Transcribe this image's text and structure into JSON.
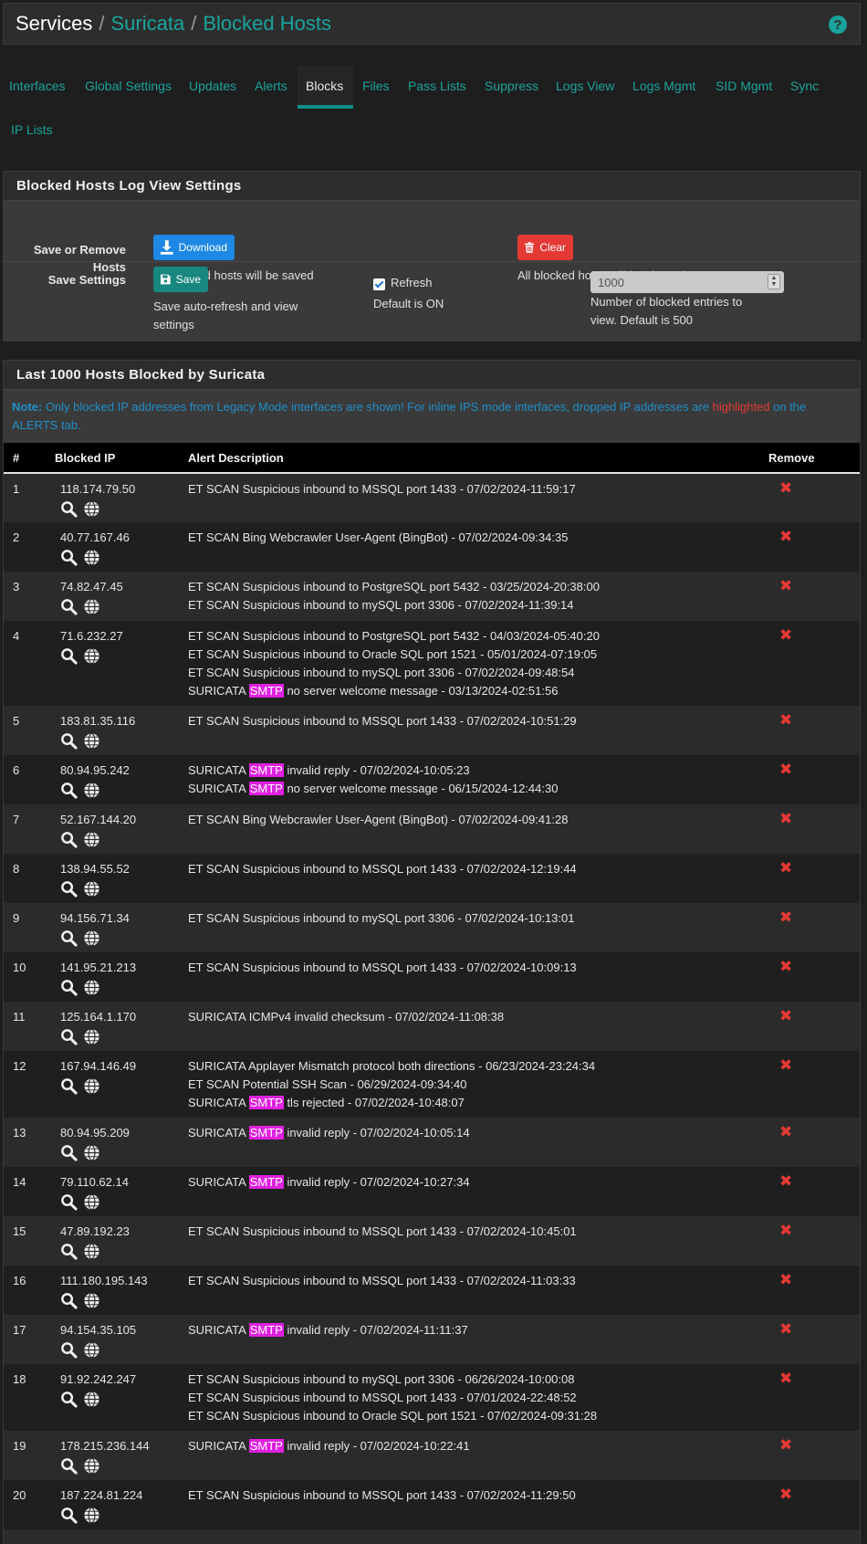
{
  "breadcrumb": {
    "root": "Services",
    "sep": "/",
    "level1": "Suricata",
    "level2": "Blocked Hosts",
    "help": "?"
  },
  "tabs": [
    "Interfaces",
    "Global Settings",
    "Updates",
    "Alerts",
    "Blocks",
    "Files",
    "Pass Lists",
    "Suppress",
    "Logs View",
    "Logs Mgmt",
    "SID Mgmt",
    "Sync",
    "IP Lists"
  ],
  "active_tab": "Blocks",
  "settings_panel": {
    "title": "Blocked Hosts Log View Settings",
    "save_remove_label_1": "Save or Remove",
    "save_remove_label_2": "Hosts",
    "download_label": "Download",
    "download_hint": "All blocked hosts will be saved",
    "clear_label": "Clear",
    "clear_hint": "All blocked hosts will be cleared",
    "save_settings_label": "Save Settings",
    "save_label": "Save",
    "save_hint_1": "Save auto-refresh and view",
    "save_hint_2": "settings",
    "refresh_label": "Refresh",
    "refresh_checked": true,
    "refresh_hint": "Default is ON",
    "entries_value": "1000",
    "entries_hint_1": "Number of blocked entries to",
    "entries_hint_2": "view. Default is 500"
  },
  "blocked_panel": {
    "title": "Last 1000 Hosts Blocked by Suricata",
    "note_label": "Note:",
    "note_text_1": " Only blocked IP addresses from Legacy Mode interfaces are shown! For inline IPS mode interfaces, dropped IP addresses are ",
    "note_highlight": "highlighted",
    "note_text_2": " on the ALERTS tab."
  },
  "table": {
    "headers": {
      "num": "#",
      "ip": "Blocked IP",
      "desc": "Alert Description",
      "remove": "Remove"
    },
    "rows": [
      {
        "num": "1",
        "ip": "118.174.79.50",
        "alerts": [
          "ET SCAN Suspicious inbound to MSSQL port 1433 - 07/02/2024-11:59:17"
        ]
      },
      {
        "num": "2",
        "ip": "40.77.167.46",
        "alerts": [
          "ET SCAN Bing Webcrawler User-Agent (BingBot) - 07/02/2024-09:34:35"
        ]
      },
      {
        "num": "3",
        "ip": "74.82.47.45",
        "alerts": [
          "ET SCAN Suspicious inbound to PostgreSQL port 5432 - 03/25/2024-20:38:00",
          "ET SCAN Suspicious inbound to mySQL port 3306 - 07/02/2024-11:39:14"
        ]
      },
      {
        "num": "4",
        "ip": "71.6.232.27",
        "alerts": [
          "ET SCAN Suspicious inbound to PostgreSQL port 5432 - 04/03/2024-05:40:20",
          "ET SCAN Suspicious inbound to Oracle SQL port 1521 - 05/01/2024-07:19:05",
          "ET SCAN Suspicious inbound to mySQL port 3306 - 07/02/2024-09:48:54",
          "SURICATA SMTP no server welcome message - 03/13/2024-02:51:56"
        ]
      },
      {
        "num": "5",
        "ip": "183.81.35.116",
        "alerts": [
          "ET SCAN Suspicious inbound to MSSQL port 1433 - 07/02/2024-10:51:29"
        ]
      },
      {
        "num": "6",
        "ip": "80.94.95.242",
        "alerts": [
          "SURICATA SMTP invalid reply - 07/02/2024-10:05:23",
          "SURICATA SMTP no server welcome message - 06/15/2024-12:44:30"
        ]
      },
      {
        "num": "7",
        "ip": "52.167.144.20",
        "alerts": [
          "ET SCAN Bing Webcrawler User-Agent (BingBot) - 07/02/2024-09:41:28"
        ]
      },
      {
        "num": "8",
        "ip": "138.94.55.52",
        "alerts": [
          "ET SCAN Suspicious inbound to MSSQL port 1433 - 07/02/2024-12:19:44"
        ]
      },
      {
        "num": "9",
        "ip": "94.156.71.34",
        "alerts": [
          "ET SCAN Suspicious inbound to mySQL port 3306 - 07/02/2024-10:13:01"
        ]
      },
      {
        "num": "10",
        "ip": "141.95.21.213",
        "alerts": [
          "ET SCAN Suspicious inbound to MSSQL port 1433 - 07/02/2024-10:09:13"
        ]
      },
      {
        "num": "11",
        "ip": "125.164.1.170",
        "alerts": [
          "SURICATA ICMPv4 invalid checksum - 07/02/2024-11:08:38"
        ]
      },
      {
        "num": "12",
        "ip": "167.94.146.49",
        "alerts": [
          "SURICATA Applayer Mismatch protocol both directions - 06/23/2024-23:24:34",
          "ET SCAN Potential SSH Scan - 06/29/2024-09:34:40",
          "SURICATA SMTP tls rejected - 07/02/2024-10:48:07"
        ]
      },
      {
        "num": "13",
        "ip": "80.94.95.209",
        "alerts": [
          "SURICATA SMTP invalid reply - 07/02/2024-10:05:14"
        ]
      },
      {
        "num": "14",
        "ip": "79.110.62.14",
        "alerts": [
          "SURICATA SMTP invalid reply - 07/02/2024-10:27:34"
        ]
      },
      {
        "num": "15",
        "ip": "47.89.192.23",
        "alerts": [
          "ET SCAN Suspicious inbound to MSSQL port 1433 - 07/02/2024-10:45:01"
        ]
      },
      {
        "num": "16",
        "ip": "111.180.195.143",
        "alerts": [
          "ET SCAN Suspicious inbound to MSSQL port 1433 - 07/02/2024-11:03:33"
        ]
      },
      {
        "num": "17",
        "ip": "94.154.35.105",
        "alerts": [
          "SURICATA SMTP invalid reply - 07/02/2024-11:11:37"
        ]
      },
      {
        "num": "18",
        "ip": "91.92.242.247",
        "alerts": [
          "ET SCAN Suspicious inbound to mySQL port 3306 - 06/26/2024-10:00:08",
          "ET SCAN Suspicious inbound to MSSQL port 1433 - 07/01/2024-22:48:52",
          "ET SCAN Suspicious inbound to Oracle SQL port 1521 - 07/02/2024-09:31:28"
        ]
      },
      {
        "num": "19",
        "ip": "178.215.236.144",
        "alerts": [
          "SURICATA SMTP invalid reply - 07/02/2024-10:22:41"
        ]
      },
      {
        "num": "20",
        "ip": "187.224.81.224",
        "alerts": [
          "ET SCAN Suspicious inbound to MSSQL port 1433 - 07/02/2024-11:29:50"
        ]
      }
    ]
  },
  "colors": {
    "accent": "#1aa39b",
    "danger": "#e53935",
    "primary": "#1e88e5",
    "smtp_highlight": "#e020e0",
    "note": "#1f8fc9"
  },
  "icons": {
    "help": "help-icon",
    "download": "download-icon",
    "clear": "trash-icon",
    "save": "save-icon",
    "lookup": "search-icon",
    "geo": "globe-icon",
    "remove": "remove-x-icon"
  }
}
